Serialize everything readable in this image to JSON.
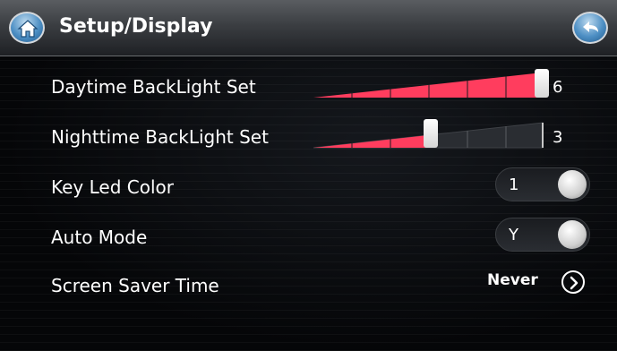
{
  "header": {
    "title": "Setup/Display",
    "home_icon": "home-icon",
    "back_icon": "back-arrow-icon"
  },
  "settings": [
    {
      "id": "daytime",
      "label": "Daytime BackLight Set",
      "type": "slider",
      "value": 6,
      "max": 6,
      "display": "6"
    },
    {
      "id": "nighttime",
      "label": "Nighttime BackLight Set",
      "type": "slider",
      "value": 3,
      "max": 6,
      "display": "3"
    },
    {
      "id": "keyled",
      "label": "Key Led Color",
      "type": "toggle",
      "display": "1"
    },
    {
      "id": "automode",
      "label": "Auto Mode",
      "type": "toggle",
      "display": "Y"
    },
    {
      "id": "screensaver",
      "label": "Screen Saver Time",
      "type": "select",
      "display": "Never",
      "icon": "chevron-right-circle-icon"
    }
  ],
  "colors": {
    "accent": "#ff3d5e",
    "track": "#3a3d42"
  }
}
